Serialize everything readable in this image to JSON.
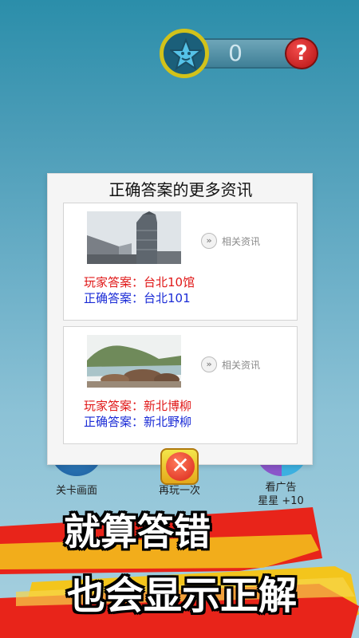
{
  "top_bar": {
    "star_count": "0",
    "help_symbol": "?"
  },
  "dialog": {
    "title": "正确答案的更多资讯",
    "cards": [
      {
        "image": "taipei-101-tower",
        "more_label": "相关资讯",
        "player_answer": "玩家答案：台北10馆",
        "correct_answer": "正确答案：台北101"
      },
      {
        "image": "coastal-rocks",
        "more_label": "相关资讯",
        "player_answer": "玩家答案：新北博柳",
        "correct_answer": "正确答案：新北野柳"
      }
    ]
  },
  "background_buttons": {
    "level_screen": "关卡画面",
    "play_again": "再玩一次",
    "watch_ad_line1": "看广告",
    "watch_ad_line2": "星星 +10"
  },
  "promo": {
    "line1": "就算答错",
    "line2": "也会显示正解"
  },
  "colors": {
    "player_answer": "#e01818",
    "correct_answer": "#1a2bd6",
    "banner_red": "#e8241a",
    "banner_yellow": "#f3c51c"
  }
}
